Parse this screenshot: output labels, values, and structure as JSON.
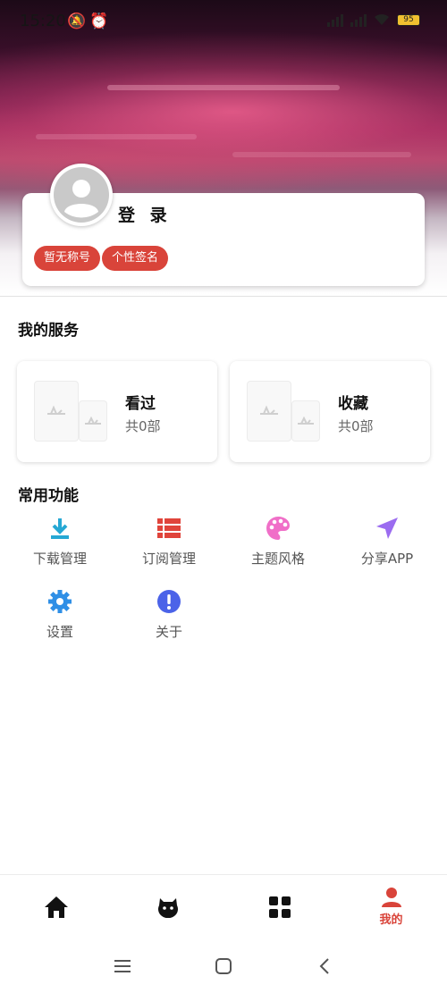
{
  "status_bar": {
    "time": "15:20",
    "battery": "95"
  },
  "profile": {
    "login_label": "登 录",
    "nickname_tag": "暂无称号",
    "signature_tag": "个性签名"
  },
  "services": {
    "title": "我的服务",
    "items": [
      {
        "label": "看过",
        "count": "共0部"
      },
      {
        "label": "收藏",
        "count": "共0部"
      }
    ]
  },
  "functions": {
    "title": "常用功能",
    "items": [
      {
        "label": "下载管理",
        "icon": "download-icon",
        "color": "#26a8d4"
      },
      {
        "label": "订阅管理",
        "icon": "list-icon",
        "color": "#e0443b"
      },
      {
        "label": "主题风格",
        "icon": "palette-icon",
        "color": "#f06fc8"
      },
      {
        "label": "分享APP",
        "icon": "share-icon",
        "color": "#9b6cf0"
      },
      {
        "label": "设置",
        "icon": "gear-icon",
        "color": "#2f8fe6"
      },
      {
        "label": "关于",
        "icon": "info-icon",
        "color": "#4b63e8"
      }
    ]
  },
  "bottom_nav": {
    "items": [
      {
        "icon": "home-icon"
      },
      {
        "icon": "mascot-icon"
      },
      {
        "icon": "grid-icon"
      },
      {
        "icon": "person-icon",
        "label": "我的"
      }
    ],
    "active_color": "#d9443a"
  },
  "system_nav": {
    "items": [
      {
        "icon": "menu-icon"
      },
      {
        "icon": "home-square-icon"
      },
      {
        "icon": "back-icon"
      }
    ]
  }
}
